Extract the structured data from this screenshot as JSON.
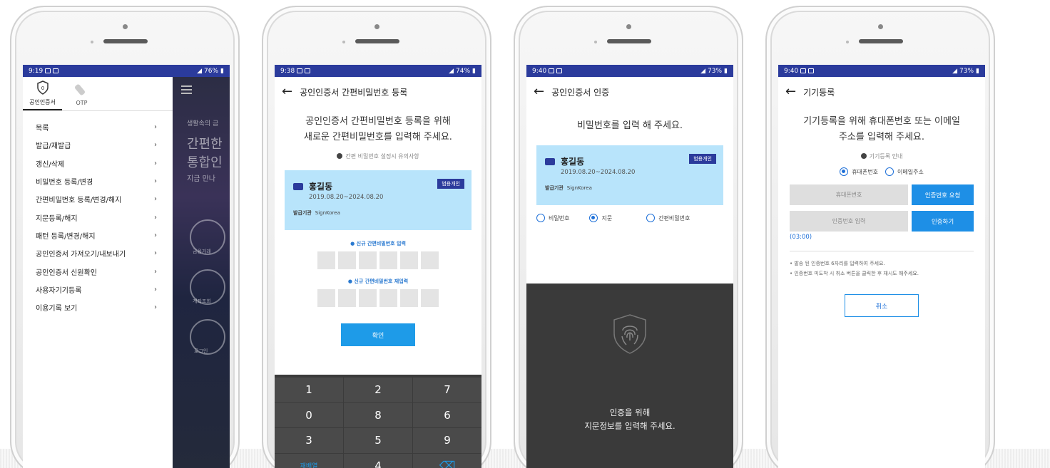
{
  "phone1": {
    "status": {
      "time": "9:19",
      "battery": "76%"
    },
    "tabs": [
      {
        "label": "공인인증서"
      },
      {
        "label": "OTP"
      }
    ],
    "menu": [
      {
        "label": "목록"
      },
      {
        "label": "발급/재발급"
      },
      {
        "label": "갱신/삭제"
      },
      {
        "label": "비밀번호 등록/변경"
      },
      {
        "label": "간편비밀번호 등록/변경/해지"
      },
      {
        "label": "지문등록/해지"
      },
      {
        "label": "패턴 등록/변경/해지"
      },
      {
        "label": "공인인증서 가져오기/내보내기"
      },
      {
        "label": "공인인증서 신원확인"
      },
      {
        "label": "사용자기기등록"
      },
      {
        "label": "이용기록 보기"
      }
    ],
    "bg_text": {
      "line1": "생활속의 금",
      "line2": "간편한",
      "line3": "통합인",
      "line4": "지금 만나"
    },
    "bg_buttons": [
      {
        "label": "금융거래"
      },
      {
        "label": "계좌조회"
      },
      {
        "label": "로그인"
      }
    ]
  },
  "phone2": {
    "status": {
      "time": "9:38",
      "battery": "74%"
    },
    "title": "공인인증서 간편비밀번호 등록",
    "headline1": "공인인증서 간편비밀번호 등록을 위해",
    "headline2": "새로운 간편비밀번호를 입력해 주세요.",
    "note": "간편 비밀번호 설정시 유의사항",
    "cert": {
      "name": "홍길동",
      "period": "2019.08.20~2024.08.20",
      "issuer_label": "발급기관",
      "issuer": "SignKorea",
      "badge": "범용개인"
    },
    "pin_label_new": "● 신규 간편비밀번호 입력",
    "pin_label_re": "● 신규 간편비밀번호 재입력",
    "confirm": "확인",
    "keypad": [
      "1",
      "2",
      "7",
      "0",
      "8",
      "6",
      "3",
      "5",
      "9",
      "재배열",
      "4",
      "⌫"
    ]
  },
  "phone3": {
    "status": {
      "time": "9:40",
      "battery": "73%"
    },
    "title": "공인인증서 인증",
    "headline": "비밀번호를 입력 해 주세요.",
    "cert": {
      "name": "홍길동",
      "period": "2019.08.20~2024.08.20",
      "issuer_label": "발급기관",
      "issuer": "SignKorea",
      "badge": "범용개인"
    },
    "options": [
      {
        "label": "비밀번호"
      },
      {
        "label": "지문"
      },
      {
        "label": "간편비밀번호"
      }
    ],
    "finger_msg1": "인증을 위해",
    "finger_msg2": "지문정보를 입력해 주세요."
  },
  "phone4": {
    "status": {
      "time": "9:40",
      "battery": "73%"
    },
    "title": "기기등록",
    "headline1": "기기등록을 위해 휴대폰번호 또는 이메일",
    "headline2": "주소를 입력해 주세요.",
    "note": "기기등록 안내",
    "options": [
      {
        "label": "휴대폰번호"
      },
      {
        "label": "이메일주소"
      }
    ],
    "phone_placeholder": "휴대폰번호",
    "request_btn": "인증번호 요청",
    "code_placeholder": "인증번호 입력",
    "verify_btn": "인증하기",
    "timer": "(03:00)",
    "bullet1": "• 발송 된 인증번호 6자리를 입력하여 주세요.",
    "bullet2": "• 인증번호 미도착 시 취소 버튼을 클릭한 후 재시도 해주세요.",
    "cancel": "취소"
  },
  "colors": {
    "statusbar": "#2b3b9c",
    "accent": "#1e9be8",
    "cert_bg": "#b8e4fb",
    "keypad": "#4a4a4a"
  }
}
